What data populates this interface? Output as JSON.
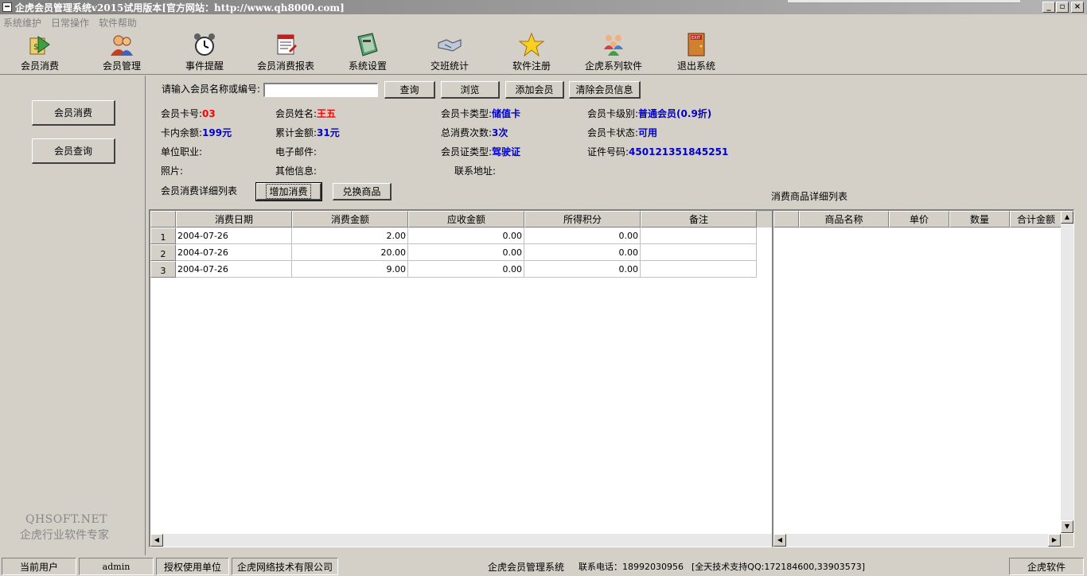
{
  "window": {
    "title": "企虎会员管理系统v2015试用版本[官方网站：http://www.qh8000.com]",
    "minimize": "_",
    "restore": "▫",
    "close": "×"
  },
  "menu": [
    "系统维护",
    "日常操作",
    "软件帮助"
  ],
  "toolbar": [
    {
      "label": "会员消费",
      "icon": "member-consume-icon"
    },
    {
      "label": "会员管理",
      "icon": "member-manage-icon"
    },
    {
      "label": "事件提醒",
      "icon": "alarm-clock-icon"
    },
    {
      "label": "会员消费报表",
      "icon": "report-icon"
    },
    {
      "label": "系统设置",
      "icon": "settings-book-icon"
    },
    {
      "label": "交班统计",
      "icon": "handshake-icon"
    },
    {
      "label": "软件注册",
      "icon": "star-icon"
    },
    {
      "label": "企虎系列软件",
      "icon": "people-group-icon"
    },
    {
      "label": "退出系统",
      "icon": "exit-door-icon"
    }
  ],
  "sidebar": {
    "buttons": [
      "会员消费",
      "会员查询"
    ],
    "brand_en": "QHSOFT.NET",
    "brand_cn": "企虎行业软件专家"
  },
  "search": {
    "label": "请输入会员名称或编号:",
    "value": "",
    "query_btn": "查询",
    "browse_btn": "浏览",
    "add_btn": "添加会员",
    "clear_btn": "清除会员信息"
  },
  "member": {
    "card_no_label": "会员卡号:",
    "card_no": "03",
    "name_label": "会员姓名:",
    "name": "王五",
    "card_type_label": "会员卡类型:",
    "card_type": "储值卡",
    "card_level_label": "会员卡级别:",
    "card_level": "普通会员(0.9折)",
    "balance_label": "卡内余额:",
    "balance": "199元",
    "total_label": "累计金额:",
    "total": "31元",
    "count_label": "总消费次数:",
    "count": "3次",
    "status_label": "会员卡状态:",
    "status": "可用",
    "job_label": "单位职业:",
    "email_label": "电子邮件:",
    "id_type_label": "会员证类型:",
    "id_type": "驾驶证",
    "id_no_label": "证件号码:",
    "id_no": "450121351845251",
    "photo_label": "照片:",
    "other_label": "其他信息:",
    "address_label": "联系地址:"
  },
  "consume_section": {
    "title": "会员消费详细列表",
    "add_btn": "增加消费",
    "exchange_btn": "兑换商品"
  },
  "consume_table": {
    "headers": [
      "消费日期",
      "消费金额",
      "应收金额",
      "所得积分",
      "备注"
    ],
    "rows": [
      {
        "no": "1",
        "date": "2004-07-26",
        "amount": "2.00",
        "receivable": "0.00",
        "points": "0.00",
        "note": ""
      },
      {
        "no": "2",
        "date": "2004-07-26",
        "amount": "20.00",
        "receivable": "0.00",
        "points": "0.00",
        "note": ""
      },
      {
        "no": "3",
        "date": "2004-07-26",
        "amount": "9.00",
        "receivable": "0.00",
        "points": "0.00",
        "note": ""
      }
    ]
  },
  "goods_section": {
    "title": "消费商品详细列表"
  },
  "goods_table": {
    "headers": [
      "商品名称",
      "单价",
      "数量",
      "合计金额"
    ]
  },
  "status": {
    "user_label": "当前用户",
    "user": "admin",
    "licensee_label": "授权使用单位",
    "licensee": "企虎网络技术有限公司",
    "system": "企虎会员管理系统",
    "phone": "联系电话：18992030956",
    "support": "[全天技术支持QQ:172184600,33903573]",
    "brand": "企虎软件"
  }
}
